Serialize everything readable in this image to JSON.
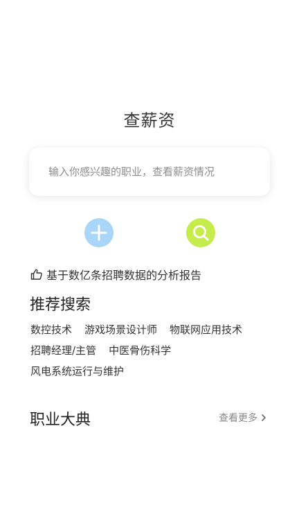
{
  "header": {
    "title": "查薪资"
  },
  "search": {
    "placeholder": "输入你感兴趣的职业，查看薪资情况"
  },
  "actions": {
    "add_icon": "plus-icon",
    "search_icon": "search-icon",
    "add_color": "#a8d5f8",
    "search_color": "#c6ec4c"
  },
  "stats": {
    "icon": "thumbs-up-icon",
    "text": "基于数亿条招聘数据的分析报告"
  },
  "recommended": {
    "title": "推荐搜索",
    "tags": [
      "数控技术",
      "游戏场景设计师",
      "物联网应用技术",
      "招聘经理/主管",
      "中医骨伤科学",
      "风电系统运行与维护"
    ]
  },
  "dictionary": {
    "title": "职业大典",
    "more_label": "查看更多",
    "more_icon": "chevron-right-icon"
  }
}
